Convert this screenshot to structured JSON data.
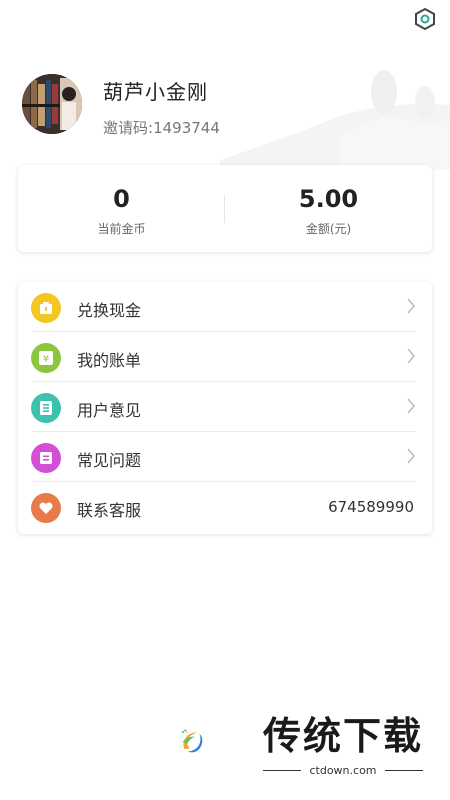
{
  "profile": {
    "username": "葫芦小金刚",
    "invite_label": "邀请码:",
    "invite_code": "1493744"
  },
  "stats": [
    {
      "value": "0",
      "label": "当前金币"
    },
    {
      "value": "5.00",
      "label": "金额(元)"
    }
  ],
  "menu": [
    {
      "label": "兑换现金",
      "icon": "wallet-icon",
      "color": "#f3c623"
    },
    {
      "label": "我的账单",
      "icon": "yen-icon",
      "color": "#8cc63f"
    },
    {
      "label": "用户意见",
      "icon": "feedback-icon",
      "color": "#3ec1ad"
    },
    {
      "label": "常见问题",
      "icon": "faq-icon",
      "color": "#d44ed6"
    },
    {
      "label": "联系客服",
      "icon": "heart-icon",
      "color": "#e87b4a",
      "value": "674589990"
    }
  ],
  "watermark": {
    "title": "传统下载",
    "url": "ctdown.com"
  },
  "colors": {
    "accent": "#2aa89a"
  }
}
